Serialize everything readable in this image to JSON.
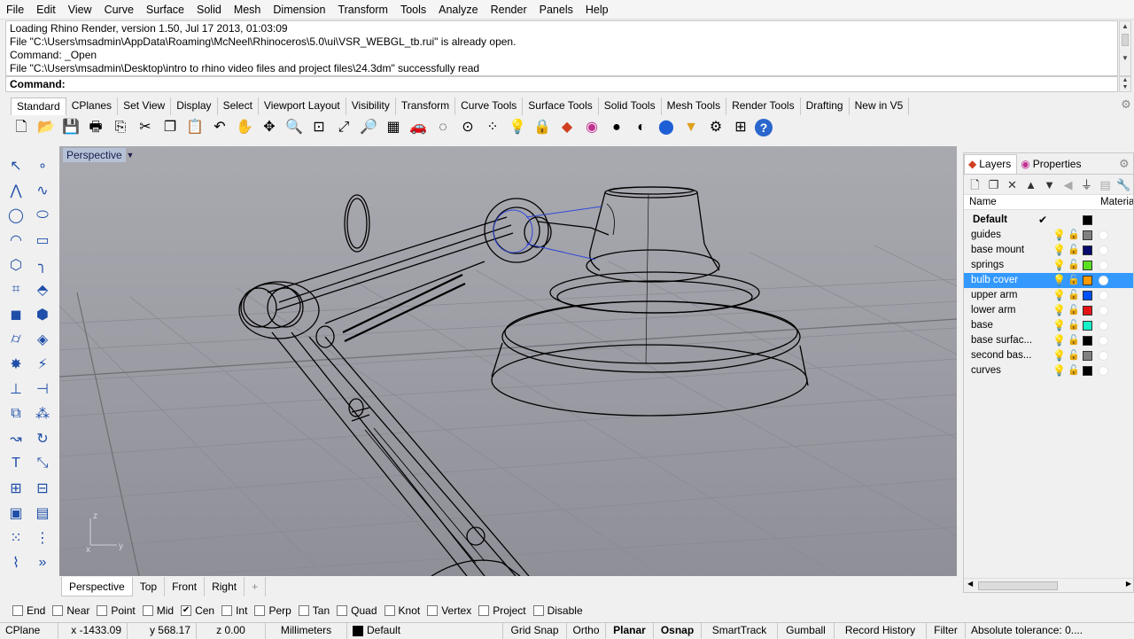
{
  "menu": [
    "File",
    "Edit",
    "View",
    "Curve",
    "Surface",
    "Solid",
    "Mesh",
    "Dimension",
    "Transform",
    "Tools",
    "Analyze",
    "Render",
    "Panels",
    "Help"
  ],
  "command_history": [
    "Loading Rhino Render, version 1.50, Jul 17 2013, 01:03:09",
    "File \"C:\\Users\\msadmin\\AppData\\Roaming\\McNeel\\Rhinoceros\\5.0\\ui\\VSR_WEBGL_tb.rui\" is already open.",
    "Command: _Open",
    "File \"C:\\Users\\msadmin\\Desktop\\intro to rhino video files and project files\\24.3dm\" successfully read"
  ],
  "command_prompt": "Command:",
  "toolbar_tabs": [
    "Standard",
    "CPlanes",
    "Set View",
    "Display",
    "Select",
    "Viewport Layout",
    "Visibility",
    "Transform",
    "Curve Tools",
    "Surface Tools",
    "Solid Tools",
    "Mesh Tools",
    "Render Tools",
    "Drafting",
    "New in V5"
  ],
  "toolbar_icons": [
    {
      "name": "new-file-icon",
      "glyph": "🗋"
    },
    {
      "name": "open-folder-icon",
      "glyph": "📂"
    },
    {
      "name": "save-icon",
      "glyph": "💾"
    },
    {
      "name": "print-icon",
      "glyph": "🖶"
    },
    {
      "name": "import-icon",
      "glyph": "⎘"
    },
    {
      "name": "cut-icon",
      "glyph": "✂"
    },
    {
      "name": "copy-icon",
      "glyph": "❐"
    },
    {
      "name": "paste-icon",
      "glyph": "📋"
    },
    {
      "name": "undo-icon",
      "glyph": "↶"
    },
    {
      "name": "pan-hand-icon",
      "glyph": "✋"
    },
    {
      "name": "move-view-icon",
      "glyph": "✥"
    },
    {
      "name": "zoom-icon",
      "glyph": "🔍"
    },
    {
      "name": "zoom-window-icon",
      "glyph": "⊡"
    },
    {
      "name": "zoom-extents-icon",
      "glyph": "⤢"
    },
    {
      "name": "zoom-selected-icon",
      "glyph": "🔎"
    },
    {
      "name": "four-viewports-icon",
      "glyph": "▦"
    },
    {
      "name": "car-icon",
      "glyph": "🚗"
    },
    {
      "name": "hide-icon",
      "glyph": "◌"
    },
    {
      "name": "cplane-icon",
      "glyph": "⊙"
    },
    {
      "name": "grid-points-icon",
      "glyph": "⁘"
    },
    {
      "name": "light-bulb-icon",
      "glyph": "💡"
    },
    {
      "name": "lock-icon",
      "glyph": "🔒"
    },
    {
      "name": "layer-icon",
      "glyph": "◆"
    },
    {
      "name": "color-wheel-icon",
      "glyph": "◉"
    },
    {
      "name": "shaded-sphere-icon",
      "glyph": "●"
    },
    {
      "name": "rendered-sphere-icon",
      "glyph": "◐"
    },
    {
      "name": "blue-sphere-icon",
      "glyph": "⬤"
    },
    {
      "name": "spotlight-icon",
      "glyph": "▼"
    },
    {
      "name": "options-gear-icon",
      "glyph": "⚙"
    },
    {
      "name": "toolbar-layout-icon",
      "glyph": "⊞"
    },
    {
      "name": "help-icon",
      "glyph": "?"
    }
  ],
  "left_tools": [
    {
      "name": "select-arrow-icon",
      "glyph": "↖"
    },
    {
      "name": "point-icon",
      "glyph": "∘"
    },
    {
      "name": "polyline-icon",
      "glyph": "⋀"
    },
    {
      "name": "curve-points-icon",
      "glyph": "∿"
    },
    {
      "name": "circle-icon",
      "glyph": "◯"
    },
    {
      "name": "ellipse-icon",
      "glyph": "⬭"
    },
    {
      "name": "arc-icon",
      "glyph": "◠"
    },
    {
      "name": "rectangle-icon",
      "glyph": "▭"
    },
    {
      "name": "polygon-icon",
      "glyph": "⬡"
    },
    {
      "name": "fillet-icon",
      "glyph": "╮"
    },
    {
      "name": "surface-points-icon",
      "glyph": "⌗"
    },
    {
      "name": "extrude-surface-icon",
      "glyph": "⬘"
    },
    {
      "name": "box-icon",
      "glyph": "◼"
    },
    {
      "name": "sphere-group-icon",
      "glyph": "⬢"
    },
    {
      "name": "cylinder-icon",
      "glyph": "⌭"
    },
    {
      "name": "mesh-plane-icon",
      "glyph": "◈"
    },
    {
      "name": "explode-icon",
      "glyph": "✸"
    },
    {
      "name": "trim-icon",
      "glyph": "⚡"
    },
    {
      "name": "split-icon",
      "glyph": "⊥"
    },
    {
      "name": "extend-icon",
      "glyph": "⊣"
    },
    {
      "name": "boolean-icon",
      "glyph": "⧉"
    },
    {
      "name": "array-icon",
      "glyph": "⁂"
    },
    {
      "name": "move-curve-icon",
      "glyph": "↝"
    },
    {
      "name": "rotate-icon",
      "glyph": "↻"
    },
    {
      "name": "text-icon",
      "glyph": "T"
    },
    {
      "name": "dimension-icon",
      "glyph": "⤡"
    },
    {
      "name": "block-icon",
      "glyph": "⊞"
    },
    {
      "name": "layout-icon",
      "glyph": "⊟"
    },
    {
      "name": "solid-box-icon",
      "glyph": "▣"
    },
    {
      "name": "hatch-icon",
      "glyph": "▤"
    },
    {
      "name": "grid-array-icon",
      "glyph": "⁙"
    },
    {
      "name": "distribute-icon",
      "glyph": "⋮"
    },
    {
      "name": "analyze-icon",
      "glyph": "⌇"
    },
    {
      "name": "more-tools-icon",
      "glyph": "»"
    }
  ],
  "viewport": {
    "title": "Perspective",
    "axis_z": "z",
    "axis_y": "y",
    "axis_x": "x",
    "tabs": [
      "Perspective",
      "Top",
      "Front",
      "Right"
    ],
    "add_tab": "+"
  },
  "panel": {
    "tabs": [
      "Layers",
      "Properties"
    ],
    "header_name": "Name",
    "header_material": "Material",
    "layers": [
      {
        "name": "Default",
        "current": true,
        "color": "#000000",
        "check": "✔"
      },
      {
        "name": "guides",
        "color": "#808080"
      },
      {
        "name": "base mount",
        "color": "#0a0a6e"
      },
      {
        "name": "springs",
        "color": "#5ae01e"
      },
      {
        "name": "bulb cover",
        "color": "#ff9900",
        "selected": true
      },
      {
        "name": "upper arm",
        "color": "#0050ff"
      },
      {
        "name": "lower arm",
        "color": "#e61414"
      },
      {
        "name": "base",
        "color": "#14f0c8"
      },
      {
        "name": "base surfac...",
        "color": "#000000",
        "bulb_off": true
      },
      {
        "name": "second bas...",
        "color": "#808080"
      },
      {
        "name": "curves",
        "color": "#000000"
      }
    ]
  },
  "osnap": [
    {
      "label": "End",
      "checked": false
    },
    {
      "label": "Near",
      "checked": false
    },
    {
      "label": "Point",
      "checked": false
    },
    {
      "label": "Mid",
      "checked": false
    },
    {
      "label": "Cen",
      "checked": true
    },
    {
      "label": "Int",
      "checked": false
    },
    {
      "label": "Perp",
      "checked": false
    },
    {
      "label": "Tan",
      "checked": false
    },
    {
      "label": "Quad",
      "checked": false
    },
    {
      "label": "Knot",
      "checked": false
    },
    {
      "label": "Vertex",
      "checked": false
    },
    {
      "label": "Project",
      "checked": false
    },
    {
      "label": "Disable",
      "checked": false
    }
  ],
  "status": {
    "cplane": "CPlane",
    "x": "x -1433.09",
    "y": "y 568.17",
    "z": "z 0.00",
    "units": "Millimeters",
    "layer": "Default",
    "grid_snap": "Grid Snap",
    "ortho": "Ortho",
    "planar": "Planar",
    "osnap": "Osnap",
    "smarttrack": "SmartTrack",
    "gumball": "Gumball",
    "record_history": "Record History",
    "filter": "Filter",
    "tolerance": "Absolute tolerance: 0...."
  }
}
